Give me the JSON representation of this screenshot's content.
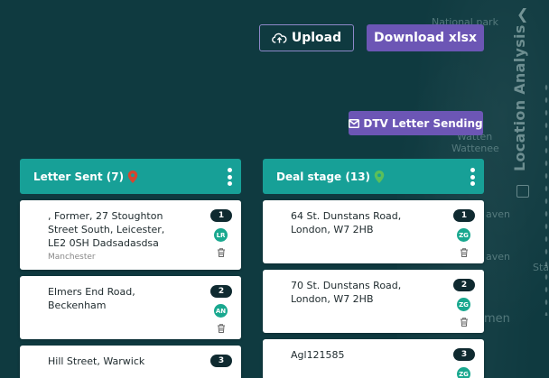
{
  "map": {
    "labels": [
      "National park",
      "Watten",
      "Wattenee",
      "aven",
      "aven",
      "Sta",
      "men"
    ]
  },
  "side_panel": {
    "title": "Location Analysis",
    "collapse_icon": "chevron-left-icon"
  },
  "toolbar": {
    "upload_label": "Upload",
    "upload_icon": "cloud-upload-icon",
    "download_label": "Download xlsx",
    "dtv_label": "DTV Letter Sending",
    "dtv_icon": "envelope-icon"
  },
  "columns": [
    {
      "title": "Letter Sent (7)",
      "pin_color": "#d6452f",
      "cards": [
        {
          "address": ", Former, 27 Stoughton Street South, Leicester, LE2 0SH Dadsadasdsa",
          "city": "Manchester",
          "number": "1",
          "initials": "LR"
        },
        {
          "address": "Elmers End Road, Beckenham",
          "city": "",
          "number": "2",
          "initials": "AN"
        },
        {
          "address": "Hill Street, Warwick",
          "city": "",
          "number": "3",
          "initials": ""
        }
      ]
    },
    {
      "title": "Deal stage (13)",
      "pin_color": "#5bbf5a",
      "cards": [
        {
          "address": "64 St. Dunstans Road, London, W7 2HB",
          "city": "",
          "number": "1",
          "initials": "ZG"
        },
        {
          "address": "70 St. Dunstans Road, London, W7 2HB",
          "city": "",
          "number": "2",
          "initials": "ZG"
        },
        {
          "address": "Agl121585",
          "city": "",
          "number": "3",
          "initials": "ZG"
        }
      ]
    }
  ]
}
